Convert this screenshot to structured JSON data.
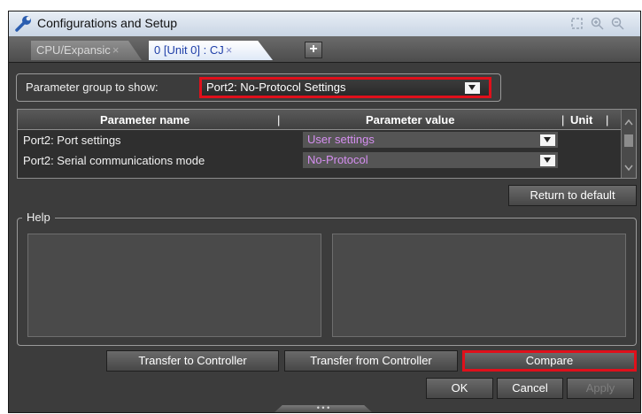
{
  "window": {
    "title": "Configurations and Setup"
  },
  "tabs": [
    {
      "label": "CPU/Expansic",
      "close": "×",
      "active": false
    },
    {
      "label": "0 [Unit 0] : CJ",
      "close": "×",
      "active": true
    }
  ],
  "add_tab_label": "+",
  "param_group": {
    "label": "Parameter group to show:",
    "selected": "Port2: No-Protocol Settings"
  },
  "table": {
    "headers": {
      "name": "Parameter name",
      "value": "Parameter value",
      "unit": "Unit"
    },
    "rows": [
      {
        "name": "Port2: Port settings",
        "value": "User settings"
      },
      {
        "name": "Port2: Serial communications mode",
        "value": "No-Protocol"
      }
    ]
  },
  "buttons": {
    "return_default": "Return to default",
    "transfer_to": "Transfer to Controller",
    "transfer_from": "Transfer from Controller",
    "compare": "Compare",
    "ok": "OK",
    "cancel": "Cancel",
    "apply": "Apply"
  },
  "help": {
    "title": "Help"
  },
  "grip_label": "• • •",
  "colors": {
    "highlight": "#e0101b",
    "value_text": "#d58ef0",
    "panel_bg": "#3c3c3c"
  },
  "icons": {
    "title": "wrench-icon",
    "toolbar": [
      "fit-icon",
      "zoom-in-icon",
      "zoom-out-icon"
    ]
  }
}
